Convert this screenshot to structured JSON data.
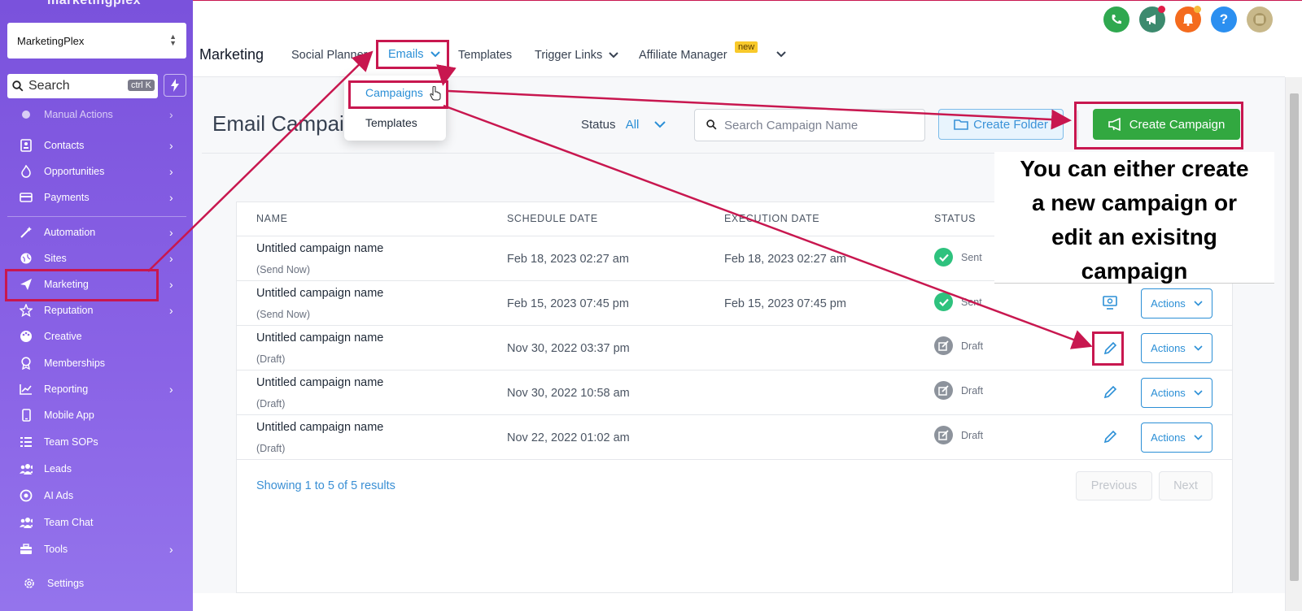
{
  "brand": "marketingplex",
  "account": {
    "name": "MarketingPlex"
  },
  "search": {
    "label": "Search",
    "shortcut": "ctrl K"
  },
  "sidebar": {
    "items": [
      {
        "label": "Manual Actions",
        "icon": "manual-icon",
        "chevron": true
      },
      {
        "label": "Contacts",
        "icon": "contacts-icon",
        "chevron": true
      },
      {
        "label": "Opportunities",
        "icon": "fire-icon",
        "chevron": true
      },
      {
        "label": "Payments",
        "icon": "card-icon",
        "chevron": true
      },
      {
        "label": "Automation",
        "icon": "wand-icon",
        "chevron": true
      },
      {
        "label": "Sites",
        "icon": "globe-icon",
        "chevron": true
      },
      {
        "label": "Marketing",
        "icon": "send-icon",
        "chevron": true
      },
      {
        "label": "Reputation",
        "icon": "star-icon",
        "chevron": true
      },
      {
        "label": "Creative",
        "icon": "palette-icon",
        "chevron": false
      },
      {
        "label": "Memberships",
        "icon": "badge-icon",
        "chevron": false
      },
      {
        "label": "Reporting",
        "icon": "chart-icon",
        "chevron": true
      },
      {
        "label": "Mobile App",
        "icon": "phone-icon",
        "chevron": false
      },
      {
        "label": "Team SOPs",
        "icon": "list-icon",
        "chevron": false
      },
      {
        "label": "Leads",
        "icon": "users-icon",
        "chevron": false
      },
      {
        "label": "AI Ads",
        "icon": "target-icon",
        "chevron": false
      },
      {
        "label": "Team Chat",
        "icon": "users-icon",
        "chevron": false
      },
      {
        "label": "Tools",
        "icon": "toolbox-icon",
        "chevron": true
      },
      {
        "label": "Settings",
        "icon": "gear-icon",
        "chevron": false
      }
    ]
  },
  "header": {
    "module": "Marketing",
    "tabs": [
      "Social Planner",
      "Emails",
      "Templates",
      "Trigger Links",
      "Affiliate Manager"
    ],
    "new_badge": "new"
  },
  "dropdown": {
    "items": [
      "Campaigns",
      "Templates"
    ]
  },
  "page": {
    "title": "Email Campaigns",
    "status_label": "Status",
    "status_value": "All",
    "search_placeholder": "Search Campaign Name",
    "create_folder": "Create Folder",
    "create_campaign": "Create Campaign"
  },
  "table": {
    "headers": [
      "NAME",
      "SCHEDULE DATE",
      "EXECUTION DATE",
      "STATUS"
    ],
    "rows": [
      {
        "name": "Untitled campaign name",
        "sub": "(Send Now)",
        "schedule": "Feb 18, 2023 02:27 am",
        "execution": "Feb 18, 2023 02:27 am",
        "status": "Sent"
      },
      {
        "name": "Untitled campaign name",
        "sub": "(Send Now)",
        "schedule": "Feb 15, 2023 07:45 pm",
        "execution": "Feb 15, 2023 07:45 pm",
        "status": "Sent"
      },
      {
        "name": "Untitled campaign name",
        "sub": "(Draft)",
        "schedule": "Nov 30, 2022 03:37 pm",
        "execution": "",
        "status": "Draft"
      },
      {
        "name": "Untitled campaign name",
        "sub": "(Draft)",
        "schedule": "Nov 30, 2022 10:58 am",
        "execution": "",
        "status": "Draft"
      },
      {
        "name": "Untitled campaign name",
        "sub": "(Draft)",
        "schedule": "Nov 22, 2022 01:02 am",
        "execution": "",
        "status": "Draft"
      }
    ],
    "actions_label": "Actions",
    "showing": "Showing 1 to 5 of 5 results",
    "previous": "Previous",
    "next": "Next"
  },
  "annotation": {
    "lines": [
      "You can either create",
      "a new campaign or",
      "edit an exisitng",
      "campaign"
    ]
  },
  "colors": {
    "accent": "#2b8fd6",
    "highlight": "#c8174f",
    "create": "#32a840",
    "sidebar": "#8a63e6"
  }
}
